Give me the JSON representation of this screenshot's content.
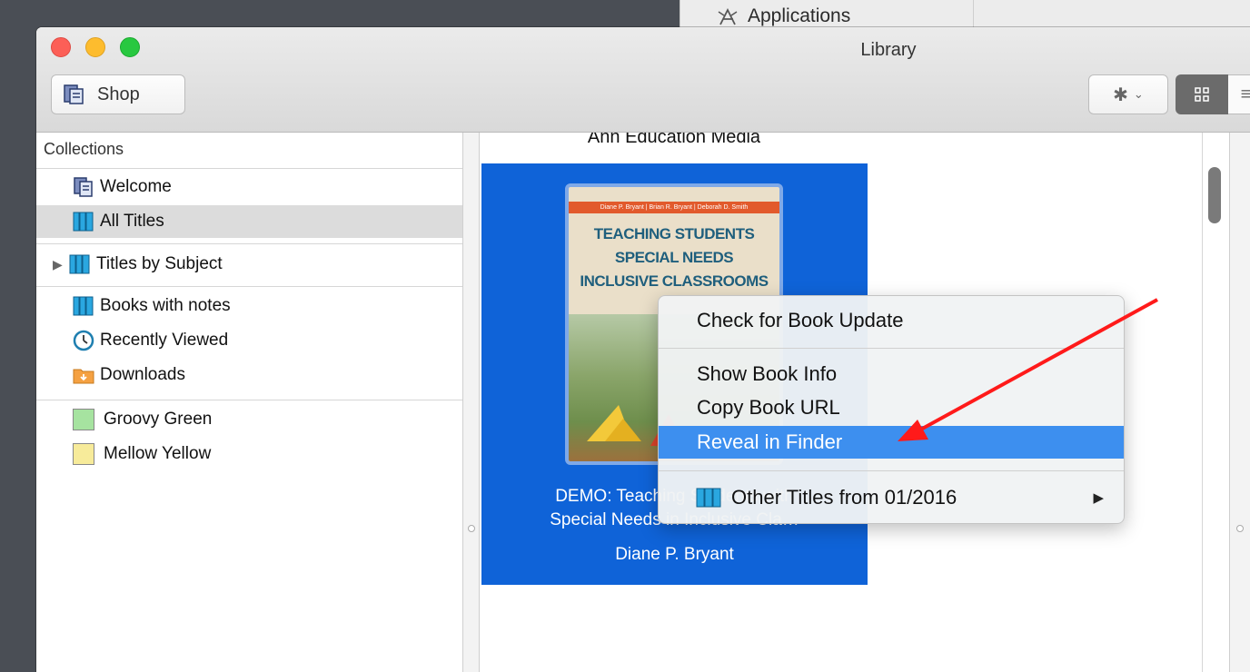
{
  "background_window": {
    "label": "Applications"
  },
  "window": {
    "title": "Library"
  },
  "toolbar": {
    "shop_label": "Shop"
  },
  "sidebar": {
    "header": "Collections",
    "items": [
      {
        "label": "Welcome",
        "icon": "welcome-icon"
      },
      {
        "label": "All Titles",
        "icon": "books-icon",
        "selected": true
      },
      {
        "label": "Titles by Subject",
        "icon": "books-icon"
      },
      {
        "label": "Books with notes",
        "icon": "books-icon"
      },
      {
        "label": "Recently Viewed",
        "icon": "clock-icon"
      },
      {
        "label": "Downloads",
        "icon": "downloads-folder-icon"
      },
      {
        "label": "Groovy Green",
        "color": "#a6e3a0"
      },
      {
        "label": "Mellow Yellow",
        "color": "#f7eb9a"
      }
    ]
  },
  "content": {
    "publisher": "Ann Education Media",
    "book": {
      "cover_authors": "Diane P. Bryant | Brian R. Bryant | Deborah D. Smith",
      "cover_title_line1": "TEACHING STUDENTS",
      "cover_title_line2": "SPECIAL NEEDS",
      "cover_title_line3": "INCLUSIVE CLASSROOMS",
      "caption_line1": "DEMO: Teaching Students with",
      "caption_line2": "Special Needs in Inclusive Cla…",
      "author": "Diane P. Bryant"
    }
  },
  "context_menu": {
    "items": [
      {
        "label": "Check for Book Update"
      },
      {
        "label": "Show Book Info"
      },
      {
        "label": "Copy Book URL"
      },
      {
        "label": "Reveal in Finder",
        "highlighted": true
      },
      {
        "label": "Other Titles from 01/2016",
        "submenu": true
      }
    ]
  },
  "colors": {
    "selection_blue": "#0f63d8",
    "menu_highlight": "#3d8fef",
    "annotation_arrow": "#ff1a1a"
  }
}
